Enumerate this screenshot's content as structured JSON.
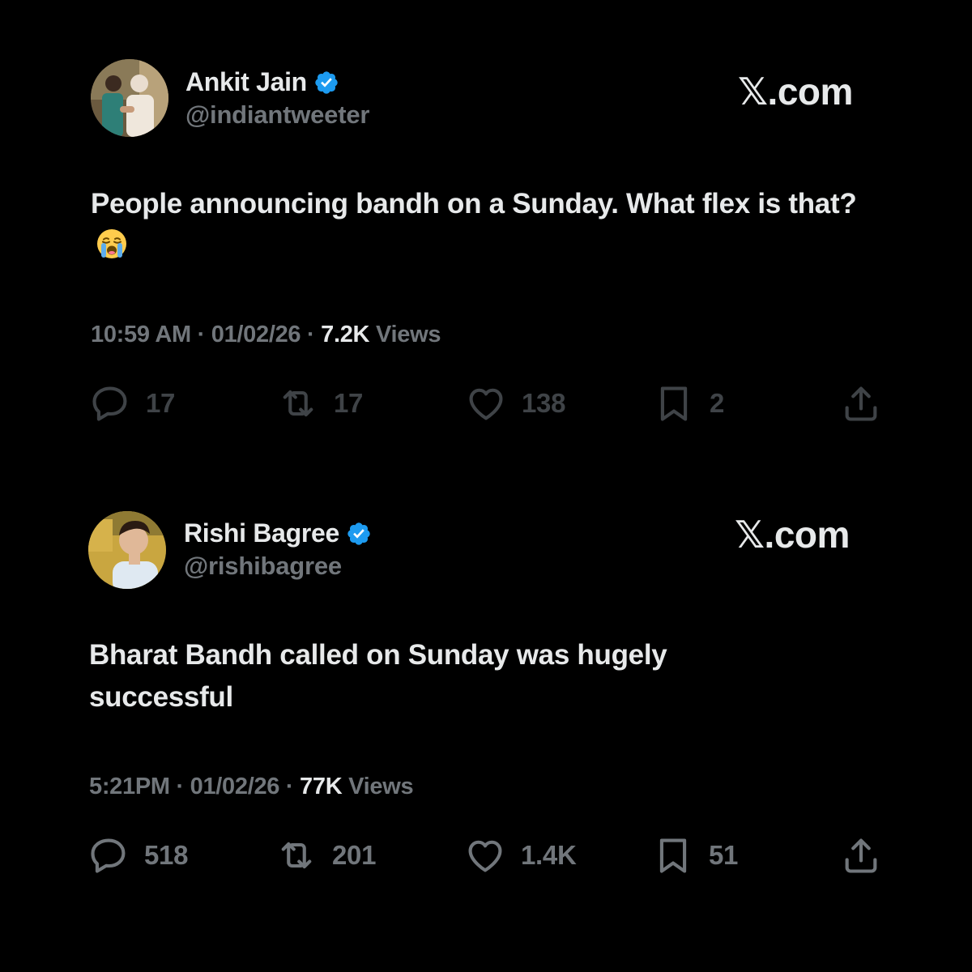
{
  "brand_label": "𝕏.com",
  "accent_color": "#1d9bf0",
  "tweets": [
    {
      "author_name": "Ankit Jain",
      "handle": "@indiantweeter",
      "verified": true,
      "text": "People announcing bandh on a Sunday. What flex is that?",
      "emoji": "loudly-crying-face",
      "time": "10:59 AM",
      "date": "01/02/26",
      "views_count": "7.2K",
      "views_label": "Views",
      "stats": {
        "replies": "17",
        "reposts": "17",
        "likes": "138",
        "bookmarks": "2"
      }
    },
    {
      "author_name": "Rishi Bagree",
      "handle": "@rishibagree",
      "verified": true,
      "text": "Bharat Bandh called on Sunday was hugely successful",
      "time": "5:21PM",
      "date": "01/02/26",
      "views_count": "77K",
      "views_label": "Views",
      "stats": {
        "replies": "518",
        "reposts": "201",
        "likes": "1.4K",
        "bookmarks": "51"
      }
    }
  ]
}
